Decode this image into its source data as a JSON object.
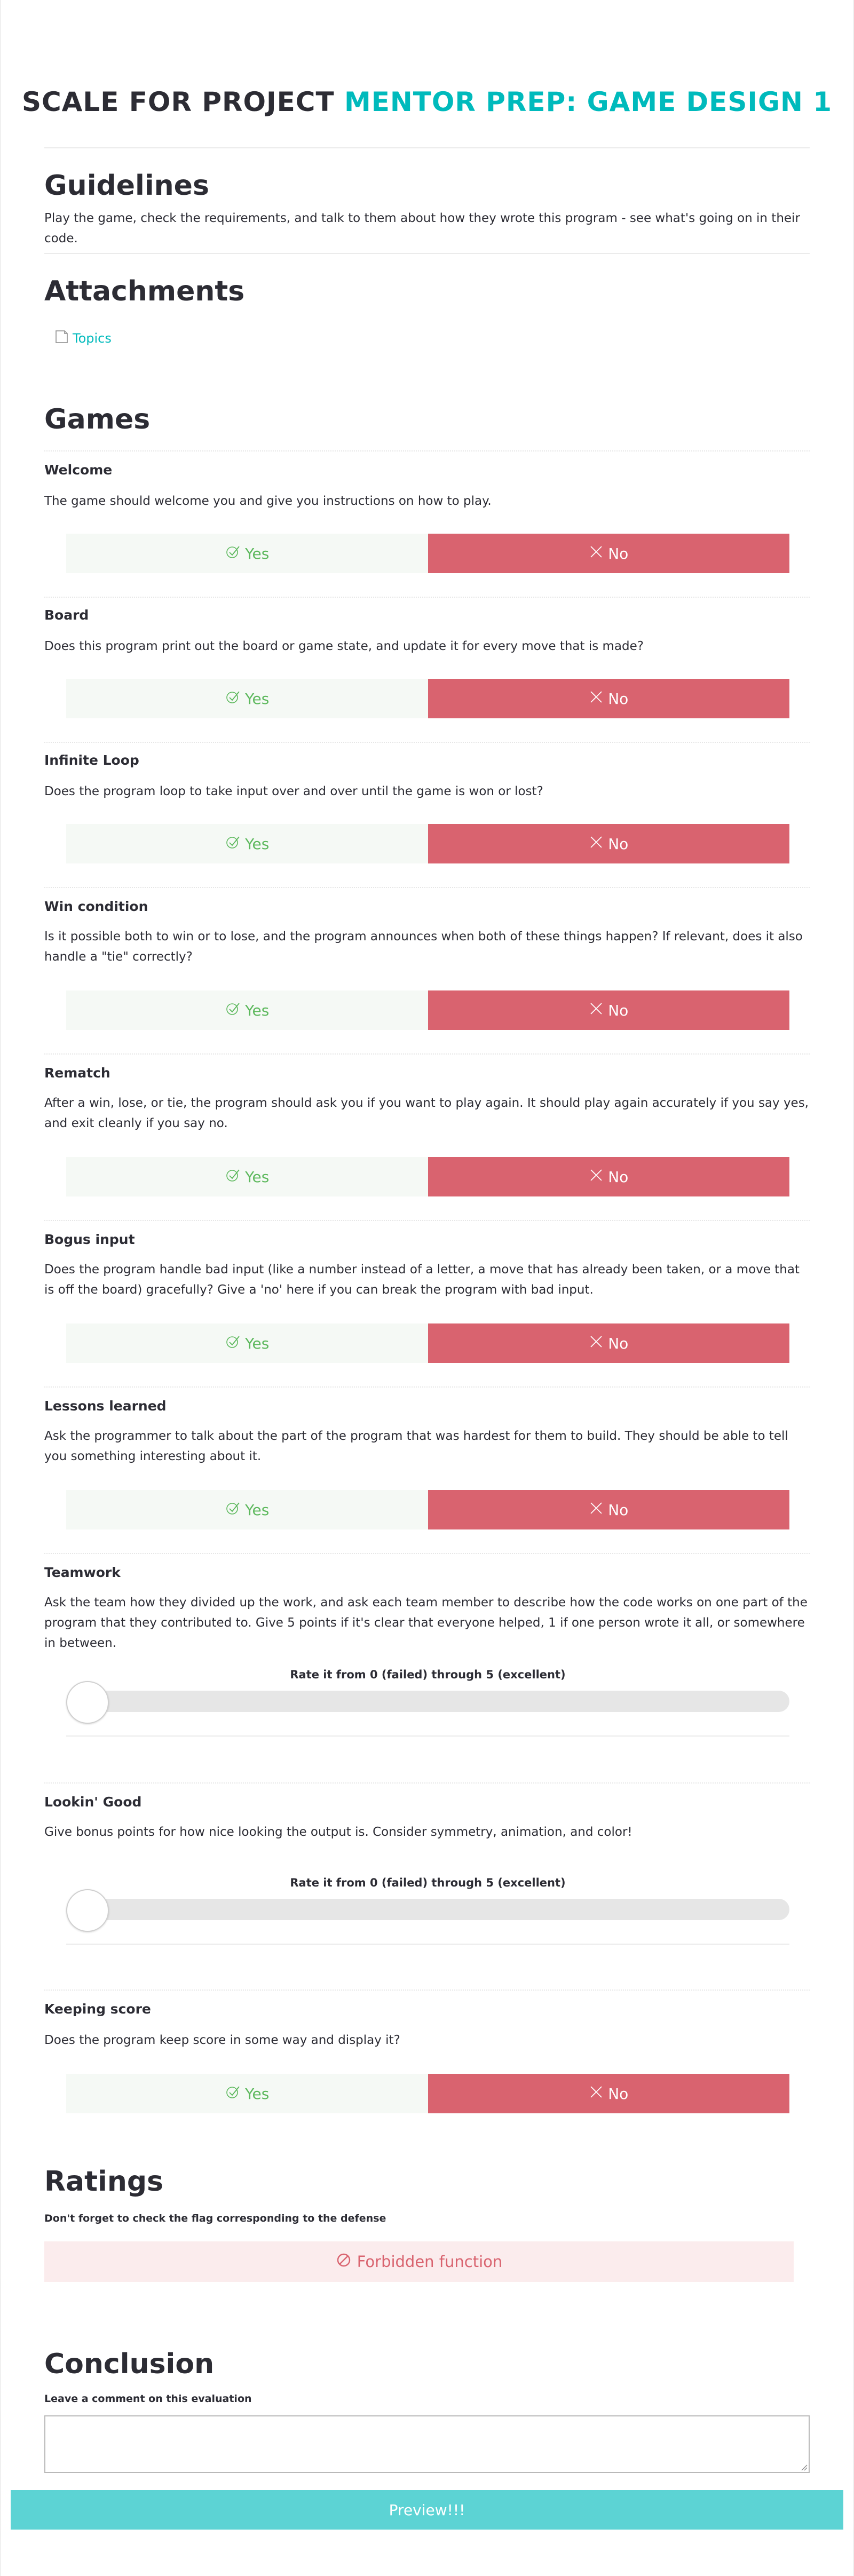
{
  "title": {
    "prefix": "SCALE FOR PROJECT",
    "project": "MENTOR PREP: GAME DESIGN 1"
  },
  "guidelines": {
    "heading": "Guidelines",
    "text": "Play the game, check the requirements, and talk to them about how they wrote this program - see what's going on in their code."
  },
  "attachments": {
    "heading": "Attachments",
    "items": [
      {
        "label": "Topics",
        "icon": "document-icon"
      }
    ]
  },
  "section": {
    "heading": "Games"
  },
  "labels": {
    "yes": "Yes",
    "no": "No",
    "rate": "Rate it from 0 (failed) through 5 (excellent)"
  },
  "questions": [
    {
      "title": "Welcome",
      "text": "The game should welcome you and give you instructions on how to play.",
      "type": "yesno"
    },
    {
      "title": "Board",
      "text": "Does this program print out the board or game state, and update it for every move that is made?",
      "type": "yesno"
    },
    {
      "title": "Infinite Loop",
      "text": "Does the program loop to take input over and over until the game is won or lost?",
      "type": "yesno"
    },
    {
      "title": "Win condition",
      "text": "Is it possible both to win or to lose, and the program announces when both of these things happen? If relevant, does it also handle a \"tie\" correctly?",
      "type": "yesno"
    },
    {
      "title": "Rematch",
      "text": "After a win, lose, or tie, the program should ask you if you want to play again. It should play again accurately if you say yes, and exit cleanly if you say no.",
      "type": "yesno"
    },
    {
      "title": "Bogus input",
      "text": "Does the program handle bad input (like a number instead of a letter, a move that has already been taken, or a move that is off the board) gracefully? Give a 'no' here if you can break the program with bad input.",
      "type": "yesno"
    },
    {
      "title": "Lessons learned",
      "text": "Ask the programmer to talk about the part of the program that was hardest for them to build. They should be able to tell you something interesting about it.",
      "type": "yesno"
    },
    {
      "title": "Teamwork",
      "text": "Ask the team how they divided up the work, and ask each team member to describe how the code works on one part of the program that they contributed to. Give 5 points if it's clear that everyone helped, 1 if one person wrote it all, or somewhere in between.",
      "type": "rating",
      "value": 0,
      "max": 5
    },
    {
      "title": "Lookin' Good",
      "text": "Give bonus points for how nice looking the output is. Consider symmetry, animation, and color!",
      "type": "rating",
      "value": 0,
      "max": 5
    },
    {
      "title": "Keeping score",
      "text": "Does the program keep score in some way and display it?",
      "type": "yesno"
    }
  ],
  "ratings": {
    "heading": "Ratings",
    "note": "Don't forget to check the flag corresponding to the defense",
    "flag_label": "Forbidden function",
    "flag_color": "#d9636f"
  },
  "conclusion": {
    "heading": "Conclusion",
    "label": "Leave a comment on this evaluation",
    "comment_value": ""
  },
  "actions": {
    "preview_label": "Preview!!!"
  },
  "colors": {
    "accent": "#00babc",
    "yes_bg": "#f5f9f5",
    "yes_text": "#5cb85c",
    "no_bg": "#d9636f",
    "button": "#5cd3d4"
  }
}
